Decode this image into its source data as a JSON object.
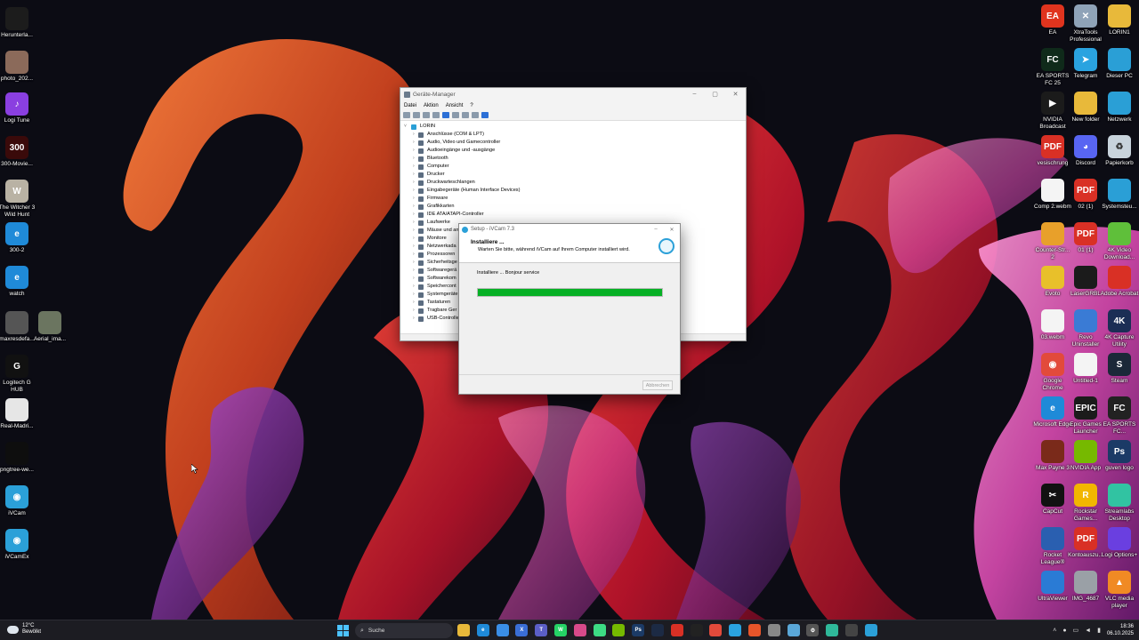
{
  "desktop": {
    "left_icons": [
      {
        "name": "herunterla-icon",
        "label": "Herunterla...",
        "color": "#1c1c1c",
        "glyph": ""
      },
      {
        "name": "photo-icon",
        "label": "photo_202...",
        "color": "#8b6a5a",
        "glyph": ""
      },
      {
        "name": "logi-tune-icon",
        "label": "Logi Tune",
        "color": "#8a3fe0",
        "glyph": "♪"
      },
      {
        "name": "movies-icon",
        "label": "300-Movie...",
        "color": "#3a0a0a",
        "glyph": "300"
      },
      {
        "name": "witcher-icon",
        "label": "The Witcher 3 Wild Hunt",
        "color": "#b9b2a4",
        "glyph": "W"
      },
      {
        "name": "edge-shortcut-icon",
        "label": "300-2",
        "color": "#1f8ad8",
        "glyph": "e"
      },
      {
        "name": "edge-watch-icon",
        "label": "watch",
        "color": "#1f8ad8",
        "glyph": "e"
      },
      {
        "name": "maxresdefault-icon",
        "label": "maxresdefa...",
        "color": "#555555",
        "glyph": ""
      },
      {
        "name": "aerial-image-icon",
        "label": "Aerial_ima...",
        "color": "#6b7560",
        "glyph": ""
      },
      {
        "name": "logitech-ghub-icon",
        "label": "Logitech G HUB",
        "color": "#111111",
        "glyph": "G"
      },
      {
        "name": "real-madrid-icon",
        "label": "Real-Madri...",
        "color": "#e6e6e6",
        "glyph": ""
      },
      {
        "name": "pngtree-icon",
        "label": "pngtree-we...",
        "color": "#0e0e0e",
        "glyph": ""
      },
      {
        "name": "ivcam-icon",
        "label": "iVCam",
        "color": "#2ba0d8",
        "glyph": "◉"
      },
      {
        "name": "ivcamex-icon",
        "label": "iVCamEx",
        "color": "#2ba0d8",
        "glyph": "◉"
      }
    ],
    "right_icons": [
      {
        "name": "ea-icon",
        "label": "EA",
        "color": "#e0341e",
        "glyph": "EA"
      },
      {
        "name": "xtratools-icon",
        "label": "XtraTools Professional",
        "color": "#8fa3b8",
        "glyph": "✕"
      },
      {
        "name": "lorin-folder-icon",
        "label": "LORIN1",
        "color": "#e8b93a",
        "glyph": ""
      },
      {
        "name": "ea-fc25-icon",
        "label": "EA SPORTS FC 25",
        "color": "#0f2a1a",
        "glyph": "FC"
      },
      {
        "name": "telegram-icon",
        "label": "Telegram",
        "color": "#2aa3e0",
        "glyph": "➤"
      },
      {
        "name": "this-pc-icon",
        "label": "Dieser PC",
        "color": "#2a9fd6",
        "glyph": ""
      },
      {
        "name": "nvidia-broadcast-icon",
        "label": "NVIDIA Broadcast",
        "color": "#1b1b1b",
        "glyph": "▶"
      },
      {
        "name": "new-folder-icon",
        "label": "New folder",
        "color": "#e8b93a",
        "glyph": ""
      },
      {
        "name": "network-icon",
        "label": "Netzwerk",
        "color": "#2a9fd6",
        "glyph": ""
      },
      {
        "name": "pdf-vesischrung-icon",
        "label": "vesischrung",
        "color": "#d93025",
        "glyph": "PDF"
      },
      {
        "name": "discord-icon",
        "label": "Discord",
        "color": "#5865f2",
        "glyph": "◕"
      },
      {
        "name": "recycle-bin-icon",
        "label": "Papierkorb",
        "color": "#c8d3dc",
        "glyph": "♻"
      },
      {
        "name": "comp-file-icon",
        "label": "Comp 2.webm",
        "color": "#f4f4f4",
        "glyph": ""
      },
      {
        "name": "pdf-02-icon",
        "label": "02 (1)",
        "color": "#d93025",
        "glyph": "PDF"
      },
      {
        "name": "system-control-icon",
        "label": "Systemsteu...",
        "color": "#2a9fd6",
        "glyph": ""
      },
      {
        "name": "counter-strike-icon",
        "label": "Counter-Str... 2",
        "color": "#e8a02a",
        "glyph": ""
      },
      {
        "name": "pdf-01-icon",
        "label": "01 (1)",
        "color": "#d93025",
        "glyph": "PDF"
      },
      {
        "name": "4k-video-icon",
        "label": "4K Video Download...",
        "color": "#5fbf3a",
        "glyph": ""
      },
      {
        "name": "evoto-icon",
        "label": "Evoto",
        "color": "#e8c02a",
        "glyph": ""
      },
      {
        "name": "lasergrbl-icon",
        "label": "LaserGRBL",
        "color": "#1b1b1b",
        "glyph": ""
      },
      {
        "name": "acrobat-icon",
        "label": "Adobe Acrobat",
        "color": "#d93025",
        "glyph": ""
      },
      {
        "name": "webm-file-icon",
        "label": "03.webm",
        "color": "#f4f4f4",
        "glyph": ""
      },
      {
        "name": "revo-uninstaller-icon",
        "label": "Revo Uninstaller",
        "color": "#3a7bd5",
        "glyph": ""
      },
      {
        "name": "4k-capture-icon",
        "label": "4K Capture Utility",
        "color": "#1b2e55",
        "glyph": "4K"
      },
      {
        "name": "chrome-icon",
        "label": "Google Chrome",
        "color": "#e24a3b",
        "glyph": "◉"
      },
      {
        "name": "untitled-icon",
        "label": "Untitled-1",
        "color": "#f4f4f4",
        "glyph": ""
      },
      {
        "name": "steam-icon",
        "label": "Steam",
        "color": "#1b2838",
        "glyph": "S"
      },
      {
        "name": "edge-icon",
        "label": "Microsoft Edge",
        "color": "#1f8ad8",
        "glyph": "e"
      },
      {
        "name": "epic-games-icon",
        "label": "Epic Games Launcher",
        "color": "#1b1b1b",
        "glyph": "EPIC"
      },
      {
        "name": "ea-fc-icon",
        "label": "EA SPORTS FC...",
        "color": "#222222",
        "glyph": "FC"
      },
      {
        "name": "max-payne-icon",
        "label": "Max Payne 3",
        "color": "#7a2a1a",
        "glyph": ""
      },
      {
        "name": "nvidia-app-icon",
        "label": "NVIDIA App",
        "color": "#76b900",
        "glyph": ""
      },
      {
        "name": "photoshop-file-icon",
        "label": "guven logo",
        "color": "#1b3a66",
        "glyph": "Ps"
      },
      {
        "name": "capcut-icon",
        "label": "CapCut",
        "color": "#111111",
        "glyph": "✂"
      },
      {
        "name": "rockstar-icon",
        "label": "Rockstar Games...",
        "color": "#f2b600",
        "glyph": "R"
      },
      {
        "name": "streamlabs-icon",
        "label": "Streamlabs Desktop",
        "color": "#31c3a2",
        "glyph": ""
      },
      {
        "name": "rocket-league-icon",
        "label": "Rocket League®",
        "color": "#2a5fb0",
        "glyph": ""
      },
      {
        "name": "pdf-kontoauszug-icon",
        "label": "Kontoauszu...",
        "color": "#d93025",
        "glyph": "PDF"
      },
      {
        "name": "logi-options-icon",
        "label": "Logi Options+",
        "color": "#6a3fe0",
        "glyph": ""
      },
      {
        "name": "ultraviewer-icon",
        "label": "UltraViewer",
        "color": "#2a7bd5",
        "glyph": ""
      },
      {
        "name": "img-4687-icon",
        "label": "IMG_4687",
        "color": "#9aa0a6",
        "glyph": ""
      },
      {
        "name": "vlc-icon",
        "label": "VLC media player",
        "color": "#f08a24",
        "glyph": "▲"
      }
    ]
  },
  "device_manager": {
    "title": "Geräte-Manager",
    "window_buttons": [
      "–",
      "▢",
      "✕"
    ],
    "menu": [
      "Datei",
      "Aktion",
      "Ansicht",
      "?"
    ],
    "root": "LORIN",
    "items": [
      "Anschlüsse (COM & LPT)",
      "Audio, Video und Gamecontroller",
      "Audioeingänge und -ausgänge",
      "Bluetooth",
      "Computer",
      "Drucker",
      "Druckwarteschlangen",
      "Eingabegeräte (Human Interface Devices)",
      "Firmware",
      "Grafikkarten",
      "IDE ATA/ATAPI-Controller",
      "Laufwerke",
      "Mäuse und an",
      "Monitore",
      "Netzwerkada",
      "Prozessoren",
      "Sicherheitsge",
      "Softwaregerä",
      "Softwarekom",
      "Speichercont",
      "Systemgeräte",
      "Tastaturen",
      "Tragbare Ger",
      "USB-Controlle"
    ]
  },
  "setup_dialog": {
    "title": "Setup - iVCam 7.3",
    "window_buttons": [
      "–",
      "✕"
    ],
    "heading": "Installiere ...",
    "subheading": "Warten Sie bitte, während iVCam auf Ihrem Computer installiert wird.",
    "status": "Installiere ... Bonjour service",
    "progress_fraction": 1.0,
    "cancel_label": "Abbrechen"
  },
  "taskbar": {
    "weather_temp": "12°C",
    "weather_desc": "Bewölkt",
    "search_label": "Suche",
    "apps": [
      {
        "name": "explorer-taskbar-icon",
        "color": "#e8b93a",
        "glyph": ""
      },
      {
        "name": "edge-taskbar-icon",
        "color": "#1f8ad8",
        "glyph": "e"
      },
      {
        "name": "store-taskbar-icon",
        "color": "#3a8ee6",
        "glyph": ""
      },
      {
        "name": "xtools-taskbar-icon",
        "color": "#3a6ed6",
        "glyph": "X"
      },
      {
        "name": "teams-taskbar-icon",
        "color": "#5b5fc7",
        "glyph": "T"
      },
      {
        "name": "whatsapp-taskbar-icon",
        "color": "#25d366",
        "glyph": "W"
      },
      {
        "name": "photos-taskbar-icon",
        "color": "#d84a8a",
        "glyph": ""
      },
      {
        "name": "android-taskbar-icon",
        "color": "#3ddc84",
        "glyph": ""
      },
      {
        "name": "nvidia-taskbar-icon",
        "color": "#76b900",
        "glyph": ""
      },
      {
        "name": "photoshop-taskbar-icon",
        "color": "#1b3a66",
        "glyph": "Ps"
      },
      {
        "name": "app-taskbar-icon",
        "color": "#1c2a44",
        "glyph": ""
      },
      {
        "name": "pdf-taskbar-icon",
        "color": "#d93025",
        "glyph": ""
      },
      {
        "name": "app2-taskbar-icon",
        "color": "#222222",
        "glyph": ""
      },
      {
        "name": "chrome-taskbar-icon",
        "color": "#e24a3b",
        "glyph": ""
      },
      {
        "name": "telegram-taskbar-icon",
        "color": "#2aa3e0",
        "glyph": ""
      },
      {
        "name": "brave-taskbar-icon",
        "color": "#e8552a",
        "glyph": ""
      },
      {
        "name": "app3-taskbar-icon",
        "color": "#888888",
        "glyph": ""
      },
      {
        "name": "app4-taskbar-icon",
        "color": "#5aa7d8",
        "glyph": ""
      },
      {
        "name": "settings-taskbar-icon",
        "color": "#555555",
        "glyph": "⚙"
      },
      {
        "name": "app5-taskbar-icon",
        "color": "#2fb89a",
        "glyph": ""
      },
      {
        "name": "app6-taskbar-icon",
        "color": "#444444",
        "glyph": ""
      },
      {
        "name": "ivcam-taskbar-icon",
        "color": "#2ba0d8",
        "glyph": ""
      }
    ],
    "time": "18:36",
    "date": "06.10.2025"
  },
  "colors": {
    "progress_green": "#06b025",
    "taskbar_bg": "#1c1c22",
    "accent_blue": "#4cc2ff"
  }
}
